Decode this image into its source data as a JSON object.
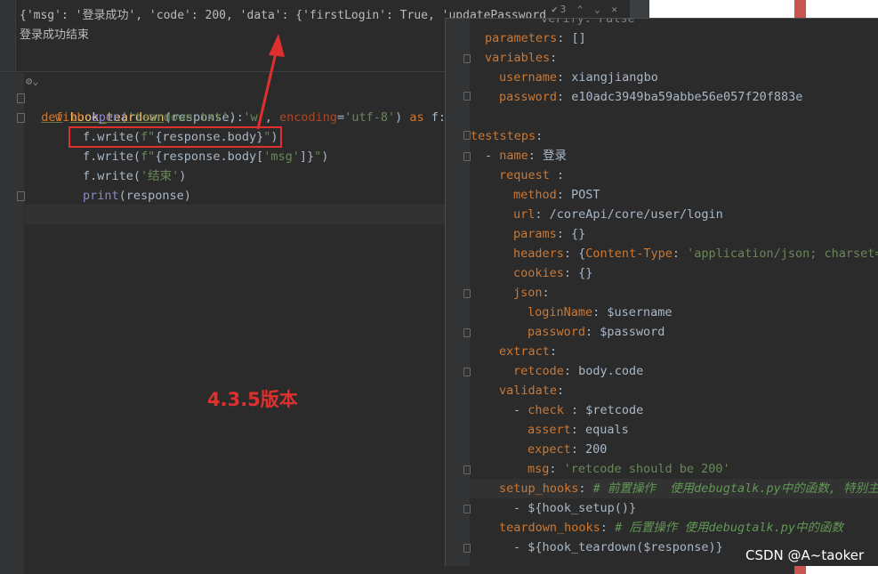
{
  "output": {
    "line1": "{'msg': '登录成功', 'code': 200, 'data': {'firstLogin': True, 'updatePassword",
    "line2": "登录成功结束"
  },
  "code": {
    "def_kw": "def",
    "fn_name": "hook_teardown",
    "fn_params": "(response):",
    "with_kw": "with",
    "open_call": "open(",
    "open_arg1": "'teardown.txt'",
    "open_sep1": ", ",
    "open_arg2": "'w'",
    "open_sep2": ", ",
    "encoding_kw": "encoding",
    "eq": "=",
    "open_arg3": "'utf-8'",
    "open_close": ") ",
    "as_kw": "as",
    "as_var": " f:",
    "l3_pre": "f.write(",
    "l3_fstr_a": "f\"",
    "l3_mid": "{response.body}",
    "l3_fstr_b": "\"",
    "l3_close": ")",
    "l4_pre": "f.write(",
    "l4_fstr_a": "f\"",
    "l4_mid_a": "{response.body[",
    "l4_key": "'msg'",
    "l4_mid_b": "]}",
    "l4_fstr_b": "\"",
    "l4_close": ")",
    "l5_pre": "f.write(",
    "l5_arg": "'结束'",
    "l5_close": ")",
    "l6_print": "print",
    "l6_rest": "(response)"
  },
  "annotation": {
    "version_label": "4.3.5版本",
    "arrow_color": "#e0302e",
    "box_color": "#e03030"
  },
  "yaml": {
    "l0": "verify: False",
    "l1_key": "parameters",
    "l1_val": ": []",
    "l2_key": "variables",
    "l2_val": ":",
    "l3_key": "username",
    "l3_val": ": xiangjiangbo",
    "l4_key": "password",
    "l4_val": ": e10adc3949ba59abbe56e057f20f883e",
    "l5_key": "teststeps",
    "l5_val": ":",
    "l6_dash": "- ",
    "l6_key": "name",
    "l6_val": ": 登录",
    "l7_key": "request",
    "l7_val": " :",
    "l8_key": "method",
    "l8_val": ": POST",
    "l9_key": "url",
    "l9_val": ": /coreApi/core/user/login",
    "l10_key": "params",
    "l10_val": ": {}",
    "l11_key": "headers",
    "l11_val_a": ": {",
    "l11_key2": "Content-Type",
    "l11_val_b": ": ",
    "l11_str": "'application/json; charset=",
    "l12_key": "cookies",
    "l12_val": ": {}",
    "l13_key": "json",
    "l13_val": ":",
    "l14_key": "loginName",
    "l14_val": ": $username",
    "l15_key": "password",
    "l15_val": ": $password",
    "l16_key": "extract",
    "l16_val": ":",
    "l17_key": "retcode",
    "l17_val": ": body.code",
    "l18_key": "validate",
    "l18_val": ":",
    "l19_dash": "- ",
    "l19_key": "check",
    "l19_val": " : $retcode",
    "l20_key": "assert",
    "l20_val": ": equals",
    "l21_key": "expect",
    "l21_val": ": 200",
    "l22_key": "msg",
    "l22_val": ": ",
    "l22_str": "'retcode should be 200'",
    "l23_key": "setup_hooks",
    "l23_val": ": ",
    "l23_cmt": "# 前置操作  使用debugtalk.py中的函数, 特别主意",
    "l24_val": "- ${hook_setup()}",
    "l25_key": "teardown_hooks",
    "l25_val": ": ",
    "l25_cmt": "# 后置操作 使用debugtalk.py中的函数",
    "l26_val": "- ${hook_teardown($response)}"
  },
  "toolbar": {
    "icons": "✔3 ⌃ ⌄ ✕"
  },
  "watermark": "CSDN @A~taoker"
}
